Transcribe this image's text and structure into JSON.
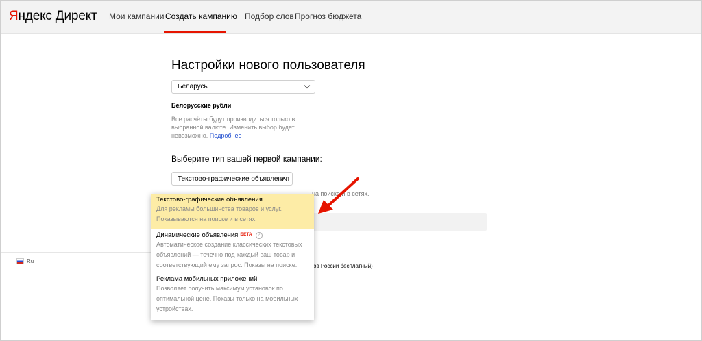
{
  "header": {
    "logo": {
      "ya": "Я",
      "rest": "ндекс Директ"
    },
    "nav": [
      {
        "label": "Мои кампании"
      },
      {
        "label": "Создать кампанию",
        "active": true
      },
      {
        "label": "Подбор слов"
      },
      {
        "label": "Прогноз бюджета"
      }
    ]
  },
  "main": {
    "title": "Настройки нового пользователя",
    "country_select": {
      "value": "Беларусь"
    },
    "currency_label": "Белорусские рубли",
    "currency_note": "Все расчёты будут производиться только в выбранной валюте. Изменить выбор будет невозможно.",
    "currency_link": "Подробнее",
    "campaign_type_heading": "Выберите тип вашей первой кампании:",
    "campaign_type_select": {
      "value": "Текстово-графические объявления"
    },
    "behind_text": "на поиске и в сетях."
  },
  "dropdown": {
    "options": [
      {
        "title": "Текстово-графические объявления",
        "desc": [
          "Для рекламы большинства товаров и услуг.",
          "Показываются на поиске и в сетях."
        ],
        "highlighted": true
      },
      {
        "title": "Динамические объявления",
        "badge": "БЕТА",
        "help": "?",
        "desc": [
          "Автоматическое создание классических текстовых",
          "объявлений — точечно под каждый ваш товар и",
          "соответствующий ему запрос. Показы на поиске."
        ]
      },
      {
        "title": "Реклама мобильных приложений",
        "desc": [
          "Позволяет получить максимум установок по",
          "оптимальной цене. Показы только на мобильных",
          "устройствах."
        ]
      }
    ]
  },
  "footer": {
    "lang": "Ru",
    "right_text": "ов России бесплатный)"
  },
  "colors": {
    "accent": "#e61400",
    "highlight": "#fdeca6",
    "link": "#2451d0",
    "arrow": "#e61400"
  }
}
